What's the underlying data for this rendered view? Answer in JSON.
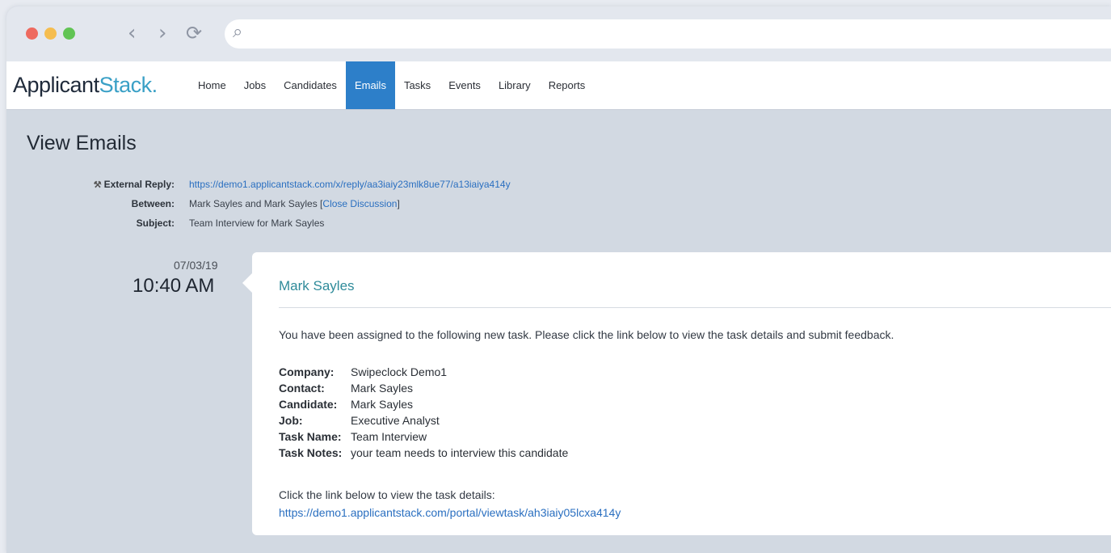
{
  "browser": {
    "back_glyph": "‹",
    "forward_glyph": "›",
    "reload_glyph": "⟳",
    "search_glyph": "⌕"
  },
  "app": {
    "logo_main": "Applicant",
    "logo_stack": "Stack",
    "logo_dot": "."
  },
  "nav": {
    "items": [
      {
        "label": "Home"
      },
      {
        "label": "Jobs"
      },
      {
        "label": "Candidates"
      },
      {
        "label": "Emails"
      },
      {
        "label": "Tasks"
      },
      {
        "label": "Events"
      },
      {
        "label": "Library"
      },
      {
        "label": "Reports"
      }
    ],
    "active": "Emails"
  },
  "page": {
    "title": "View Emails",
    "external_reply_label": "External Reply:",
    "external_reply_url": "https://demo1.applicantstack.com/x/reply/aa3iaiy23mlk8ue77/a13iaiya414y",
    "between_label": "Between:",
    "between_value": "Mark Sayles and Mark Sayles [",
    "close_discussion": "Close Discussion",
    "between_close": "]",
    "subject_label": "Subject:",
    "subject_value": "Team Interview for Mark Sayles"
  },
  "message": {
    "date": "07/03/19",
    "time": "10:40 AM",
    "sender": "Mark Sayles",
    "intro": "You have been assigned to the following new task. Please click the link below to view the task details and submit feedback.",
    "details": [
      {
        "key": "Company:",
        "value": "Swipeclock Demo1"
      },
      {
        "key": "Contact:",
        "value": "Mark Sayles"
      },
      {
        "key": "Candidate:",
        "value": "Mark Sayles"
      },
      {
        "key": "Job:",
        "value": "Executive Analyst"
      },
      {
        "key": "Task Name:",
        "value": "Team Interview"
      },
      {
        "key": "Task Notes:",
        "value": "your team needs to interview this candidate"
      }
    ],
    "footer_text": "Click the link below to view the task details:",
    "footer_link": "https://demo1.applicantstack.com/portal/viewtask/ah3iaiy05lcxa414y"
  },
  "colors": {
    "accent": "#2d7fc9",
    "link": "#2a6fc0",
    "sender": "#2f8b9a",
    "background": "#d2d9e2"
  }
}
